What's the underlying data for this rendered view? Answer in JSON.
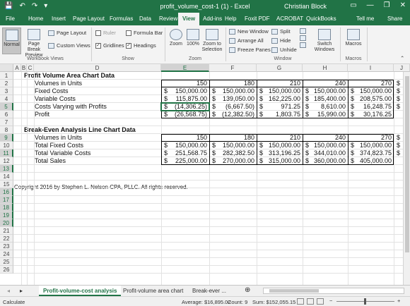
{
  "titlebar": {
    "document_title": "profit_volume_cost-1 (1)  -  Excel",
    "user_name": "Christian Block",
    "qat": {
      "save": "💾",
      "undo": "↶",
      "redo": "↷",
      "customize": "▾"
    },
    "window_controls": {
      "ribbon_options": "▭",
      "minimize": "—",
      "restore": "❐",
      "close": "✕"
    }
  },
  "ribbon": {
    "tabs": [
      "File",
      "Home",
      "Insert",
      "Page Layout",
      "Formulas",
      "Data",
      "Review",
      "View",
      "Add-ins",
      "Help",
      "Foxit PDF",
      "ACROBAT",
      "QuickBooks",
      "Tell me",
      "Share"
    ],
    "active_tab": "View",
    "workbook_views": {
      "label": "Workbook Views",
      "normal": "Normal",
      "page_break_preview": "Page Break Preview",
      "page_layout": "Page Layout",
      "custom_views": "Custom Views"
    },
    "show": {
      "label": "Show",
      "ruler": "Ruler",
      "formula_bar": "Formula Bar",
      "gridlines": "Gridlines",
      "headings": "Headings"
    },
    "zoom": {
      "label": "Zoom",
      "zoom": "Zoom",
      "hundred": "100%",
      "zoom_to_selection": "Zoom to Selection"
    },
    "window": {
      "label": "Window",
      "new_window": "New Window",
      "arrange_all": "Arrange All",
      "freeze_panes": "Freeze Panes",
      "split": "Split",
      "hide": "Hide",
      "unhide": "Unhide",
      "switch_windows": "Switch Windows"
    },
    "macros": {
      "label": "Macros",
      "macros": "Macros"
    }
  },
  "grid": {
    "columns": [
      "A",
      "B",
      "C",
      "D",
      "E",
      "F",
      "G",
      "H",
      "I",
      "J"
    ],
    "selected_column": "E",
    "rows": [
      "1",
      "2",
      "3",
      "4",
      "5",
      "6",
      "7",
      "8",
      "9",
      "10",
      "11",
      "12",
      "13",
      "14",
      "15",
      "16",
      "17",
      "18",
      "19",
      "20",
      "21",
      "22",
      "23",
      "24",
      "25",
      "26"
    ],
    "selected_rows": [
      "5",
      "9",
      "11",
      "13",
      "16",
      "17",
      "18",
      "19",
      "20"
    ],
    "pv_title": "Profit Volume Area Chart Data",
    "be_title": "Break-Even Analysis Line Chart Data",
    "pv_labels": [
      "Volumes in Units",
      "Fixed Costs",
      "Variable Costs",
      "Costs Varying with Profits",
      "Profit"
    ],
    "be_labels": [
      "Volumes in Units",
      "Total Fixed Costs",
      "Total Variable Costs",
      "Total Sales"
    ],
    "copyright": "Copyright 2016 by Stephen L. Nelson CPA, PLLC. All rights reserved.",
    "currency_symbol": "$",
    "pv_values": [
      [
        "150",
        "180",
        "210",
        "240",
        "270"
      ],
      [
        "150,000.00",
        "150,000.00",
        "150,000.00",
        "150,000.00",
        "150,000.00"
      ],
      [
        "115,875.00",
        "139,050.00",
        "162,225.00",
        "185,400.00",
        "208,575.00"
      ],
      [
        "(14,306.25)",
        "(6,667.50)",
        "971.25",
        "8,610.00",
        "16,248.75"
      ],
      [
        "(26,568.75)",
        "(12,382.50)",
        "1,803.75",
        "15,990.00",
        "30,176.25"
      ]
    ],
    "be_values": [
      [
        "150",
        "180",
        "210",
        "240",
        "270"
      ],
      [
        "150,000.00",
        "150,000.00",
        "150,000.00",
        "150,000.00",
        "150,000.00"
      ],
      [
        "251,568.75",
        "282,382.50",
        "313,196.25",
        "344,010.00",
        "374,823.75"
      ],
      [
        "225,000.00",
        "270,000.00",
        "315,000.00",
        "360,000.00",
        "405,000.00"
      ]
    ]
  },
  "sheets": {
    "tabs": [
      "Profit-volume-cost analysis",
      "Profit-volume area chart",
      "Break-ever ..."
    ],
    "active": "Profit-volume-cost analysis",
    "add_sheet": "⊕",
    "nav_prev": "◂",
    "nav_next": "▸"
  },
  "statusbar": {
    "mode": "Calculate",
    "average": "Average: $16,895.02",
    "count": "Count: 9",
    "sum": "Sum: $152,055.15",
    "zoom_minus": "−",
    "zoom_plus": "+"
  },
  "colors": {
    "excel_green": "#217346",
    "ribbon_bg": "#f3f3f3",
    "header_bg": "#efefef"
  }
}
